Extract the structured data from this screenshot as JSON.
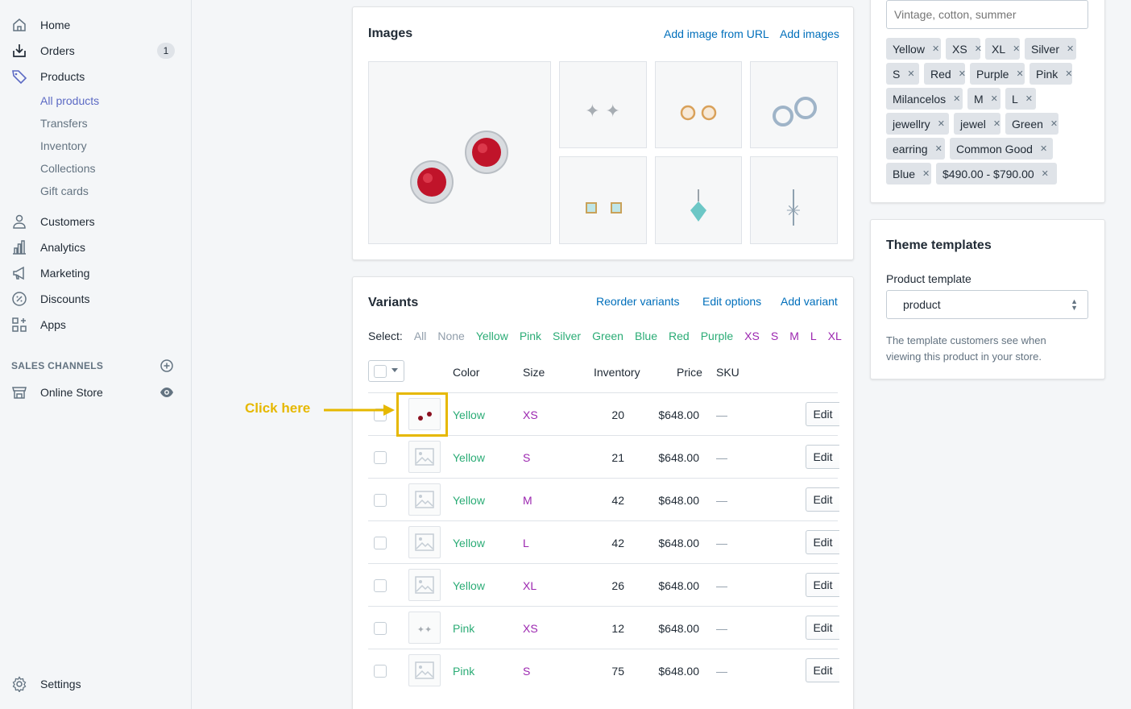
{
  "sidebar": {
    "items": [
      {
        "label": "Home",
        "icon": "home-icon"
      },
      {
        "label": "Orders",
        "icon": "orders-icon",
        "badge": "1"
      },
      {
        "label": "Products",
        "icon": "tag-icon"
      }
    ],
    "sub_items": [
      "All products",
      "Transfers",
      "Inventory",
      "Collections",
      "Gift cards"
    ],
    "items2": [
      {
        "label": "Customers",
        "icon": "person-icon"
      },
      {
        "label": "Analytics",
        "icon": "bar-chart-icon"
      },
      {
        "label": "Marketing",
        "icon": "megaphone-icon"
      },
      {
        "label": "Discounts",
        "icon": "discount-icon"
      },
      {
        "label": "Apps",
        "icon": "apps-icon"
      }
    ],
    "sales_channels_heading": "SALES CHANNELS",
    "online_store": "Online Store",
    "settings": "Settings"
  },
  "images_card": {
    "title": "Images",
    "add_from_url": "Add image from URL",
    "add_images": "Add images"
  },
  "variants_card": {
    "title": "Variants",
    "reorder": "Reorder variants",
    "edit_options": "Edit options",
    "add_variant": "Add variant",
    "select_label": "Select:",
    "select_options": [
      {
        "label": "All",
        "color": "#919eab"
      },
      {
        "label": "None",
        "color": "#919eab"
      },
      {
        "label": "Yellow",
        "color": "#2bac76"
      },
      {
        "label": "Pink",
        "color": "#2bac76"
      },
      {
        "label": "Silver",
        "color": "#2bac76"
      },
      {
        "label": "Green",
        "color": "#2bac76"
      },
      {
        "label": "Blue",
        "color": "#2bac76"
      },
      {
        "label": "Red",
        "color": "#2bac76"
      },
      {
        "label": "Purple",
        "color": "#2bac76"
      },
      {
        "label": "XS",
        "color": "#9c27b0"
      },
      {
        "label": "S",
        "color": "#9c27b0"
      },
      {
        "label": "M",
        "color": "#9c27b0"
      },
      {
        "label": "L",
        "color": "#9c27b0"
      },
      {
        "label": "XL",
        "color": "#9c27b0"
      }
    ],
    "headers": {
      "color": "Color",
      "size": "Size",
      "inventory": "Inventory",
      "price": "Price",
      "sku": "SKU"
    },
    "rows": [
      {
        "color": "Yellow",
        "size": "XS",
        "inventory": "20",
        "price": "$648.00",
        "sku": "—",
        "thumb": "ruby"
      },
      {
        "color": "Yellow",
        "size": "S",
        "inventory": "21",
        "price": "$648.00",
        "sku": "—",
        "thumb": "placeholder"
      },
      {
        "color": "Yellow",
        "size": "M",
        "inventory": "42",
        "price": "$648.00",
        "sku": "—",
        "thumb": "placeholder"
      },
      {
        "color": "Yellow",
        "size": "L",
        "inventory": "42",
        "price": "$648.00",
        "sku": "—",
        "thumb": "placeholder"
      },
      {
        "color": "Yellow",
        "size": "XL",
        "inventory": "26",
        "price": "$648.00",
        "sku": "—",
        "thumb": "placeholder"
      },
      {
        "color": "Pink",
        "size": "XS",
        "inventory": "12",
        "price": "$648.00",
        "sku": "—",
        "thumb": "studs"
      },
      {
        "color": "Pink",
        "size": "S",
        "inventory": "75",
        "price": "$648.00",
        "sku": "—",
        "thumb": "placeholder"
      }
    ],
    "edit_label": "Edit"
  },
  "annotation": {
    "text": "Click here",
    "color": "#e6b800"
  },
  "tags_card": {
    "placeholder": "Vintage, cotton, summer",
    "tags": [
      [
        "Yellow",
        "XS",
        "XL",
        "Silver"
      ],
      [
        "S",
        "Red",
        "Purple",
        "Pink"
      ],
      [
        "Milancelos",
        "M",
        "L"
      ],
      [
        "jewellry",
        "jewel",
        "Green"
      ],
      [
        "earring",
        "Common Good"
      ],
      [
        "Blue",
        "$490.00 - $790.00"
      ]
    ]
  },
  "theme_card": {
    "title": "Theme templates",
    "label": "Product template",
    "value": "product",
    "help": "The template customers see when viewing this product in your store."
  },
  "colors": {
    "link": "#006fbb",
    "color_text": "#2bac76",
    "size_text": "#9c27b0",
    "accent": "#5c6ac4"
  }
}
